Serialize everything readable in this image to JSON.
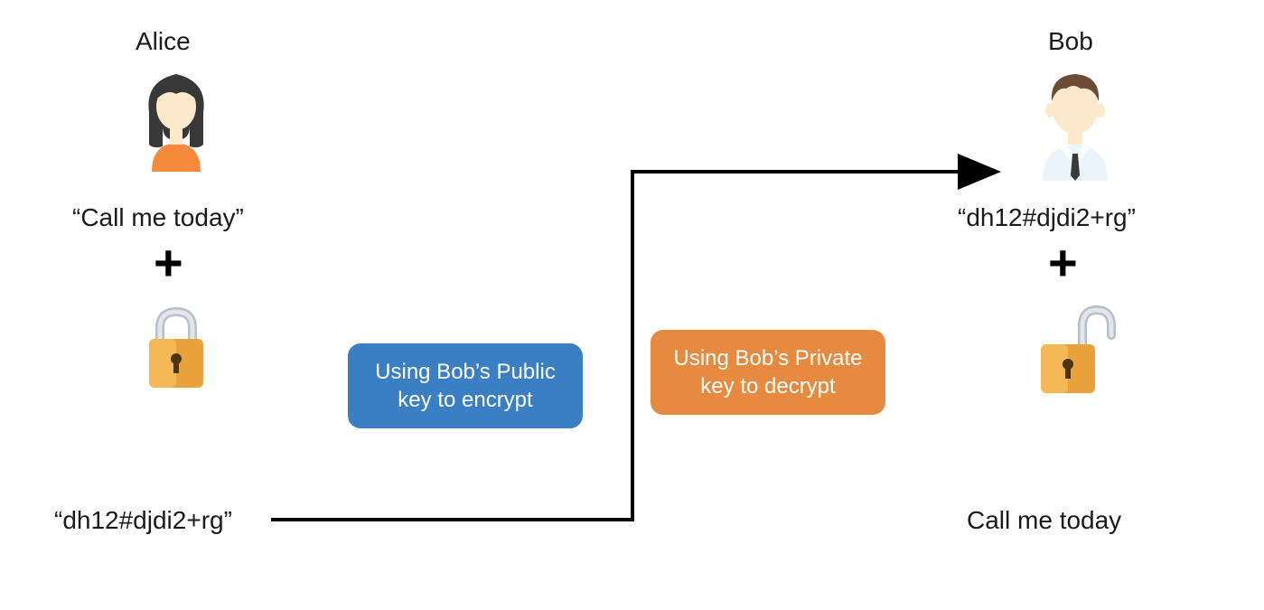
{
  "alice": {
    "name": "Alice",
    "plaintext": "“Call me today”",
    "ciphertext": "“dh12#djdi2+rg”"
  },
  "bob": {
    "name": "Bob",
    "ciphertext_received": "“dh12#djdi2+rg”",
    "plaintext_decrypted": "Call me today"
  },
  "callouts": {
    "encrypt": "Using Bob’s Public key to encrypt",
    "decrypt": "Using Bob’s Private key to decrypt"
  }
}
